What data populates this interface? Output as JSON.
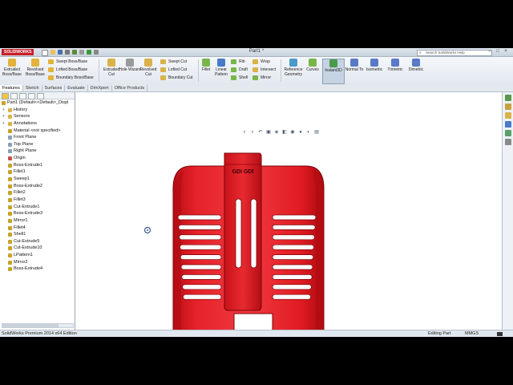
{
  "app": {
    "logo": "SOLIDWORKS",
    "document_title": "Part1 *",
    "search_placeholder": "Search SolidWorks Help"
  },
  "ribbon": {
    "extruded_boss": "Extruded Boss/Base",
    "revolved_boss": "Revolved Boss/Base",
    "swept_boss": "Swept Boss/Base",
    "lofted_boss": "Lofted Boss/Base",
    "boundary_boss": "Boundary Boss/Base",
    "extruded_cut": "Extruded Cut",
    "hole_wizard": "Hole Wizard",
    "revolved_cut": "Revolved Cut",
    "swept_cut": "Swept Cut",
    "lofted_cut": "Lofted Cut",
    "boundary_cut": "Boundary Cut",
    "fillet": "Fillet",
    "linear_pattern": "Linear Pattern",
    "rib": "Rib",
    "draft": "Draft",
    "shell": "Shell",
    "wrap": "Wrap",
    "intersect": "Intersect",
    "mirror": "Mirror",
    "reference_geometry": "Reference Geometry",
    "curves": "Curves",
    "instant3d": "Instant3D",
    "normal_to": "Normal To",
    "isometric": "Isometric",
    "trimetric": "Trimetric",
    "dimetric": "Dimetric"
  },
  "tabs": [
    "Features",
    "Sketch",
    "Surfaces",
    "Evaluate",
    "DimXpert",
    "Office Products"
  ],
  "feature_tree": [
    {
      "label": "Part1  (Default<<Default>_Displ",
      "icon": "part-icon",
      "color": "#c9a227"
    },
    {
      "label": "History",
      "icon": "history-icon",
      "color": "#d9b34a"
    },
    {
      "label": "Sensors",
      "icon": "sensors-icon",
      "color": "#d9b34a"
    },
    {
      "label": "Annotations",
      "icon": "annotations-icon",
      "color": "#d9b34a"
    },
    {
      "label": "Material <not specified>",
      "icon": "material-icon",
      "color": "#c9a227"
    },
    {
      "label": "Front Plane",
      "icon": "plane-icon",
      "color": "#8aa0b8"
    },
    {
      "label": "Top Plane",
      "icon": "plane-icon",
      "color": "#8aa0b8"
    },
    {
      "label": "Right Plane",
      "icon": "plane-icon",
      "color": "#8aa0b8"
    },
    {
      "label": "Origin",
      "icon": "origin-icon",
      "color": "#c85050"
    },
    {
      "label": "Boss-Extrude1",
      "icon": "feature-icon",
      "color": "#c9a227"
    },
    {
      "label": "Fillet1",
      "icon": "fillet-icon",
      "color": "#c9a227"
    },
    {
      "label": "Sweep1",
      "icon": "feature-icon",
      "color": "#c9a227"
    },
    {
      "label": "Boss-Extrude2",
      "icon": "feature-icon",
      "color": "#c9a227"
    },
    {
      "label": "Fillet2",
      "icon": "fillet-icon",
      "color": "#c9a227"
    },
    {
      "label": "Fillet3",
      "icon": "fillet-icon",
      "color": "#c9a227"
    },
    {
      "label": "Cut-Extrude1",
      "icon": "feature-icon",
      "color": "#c9a227"
    },
    {
      "label": "Boss-Extrude3",
      "icon": "feature-icon",
      "color": "#c9a227"
    },
    {
      "label": "Mirror1",
      "icon": "mirror-icon",
      "color": "#c9a227"
    },
    {
      "label": "Fillet4",
      "icon": "fillet-icon",
      "color": "#c9a227"
    },
    {
      "label": "Shell1",
      "icon": "shell-icon",
      "color": "#c9a227"
    },
    {
      "label": "Cut-Extrude5",
      "icon": "feature-icon",
      "color": "#c9a227"
    },
    {
      "label": "Cut-Extrude10",
      "icon": "feature-icon",
      "color": "#c9a227"
    },
    {
      "label": "LPattern1",
      "icon": "pattern-icon",
      "color": "#c9a227"
    },
    {
      "label": "Mirror2",
      "icon": "mirror-icon",
      "color": "#c9a227"
    },
    {
      "label": "Boss-Extrude4",
      "icon": "feature-icon",
      "color": "#c9a227"
    }
  ],
  "model": {
    "color": "#e0151d",
    "logo_text": "GDI GDI"
  },
  "status": {
    "edition": "SolidWorks Premium 2014 x64 Edition",
    "mode": "Editing Part",
    "units": "MMGS"
  }
}
